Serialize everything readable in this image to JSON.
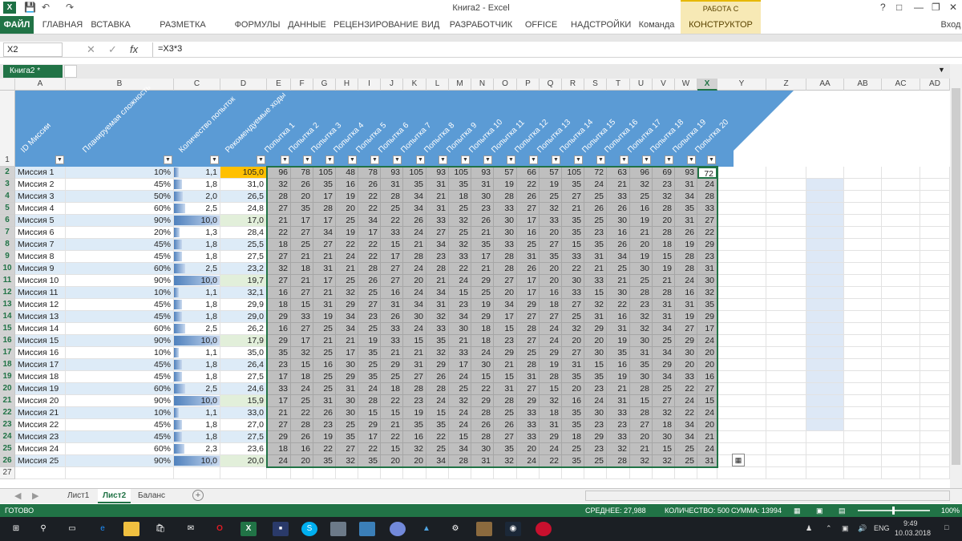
{
  "window": {
    "title": "Книга2 - Excel",
    "context_title": "РАБОТА С ТАБЛИЦАМИ",
    "help": "?",
    "user": "Вход"
  },
  "ribbon_tabs": [
    "ФАЙЛ",
    "ГЛАВНАЯ",
    "ВСТАВКА",
    "РАЗМЕТКА СТРАНИЦЫ",
    "ФОРМУЛЫ",
    "ДАННЫЕ",
    "РЕЦЕНЗИРОВАНИЕ",
    "ВИД",
    "РАЗРАБОТЧИК",
    "OFFICE TAB",
    "НАДСТРОЙКИ",
    "Команда",
    "КОНСТРУКТОР"
  ],
  "formula_bar": {
    "name_box": "X2",
    "fx": "fx",
    "formula": "=X3*3"
  },
  "workbook_tab": "Книга2 *",
  "columns": [
    "A",
    "B",
    "C",
    "D",
    "E",
    "F",
    "G",
    "H",
    "I",
    "J",
    "K",
    "L",
    "M",
    "N",
    "O",
    "P",
    "Q",
    "R",
    "S",
    "T",
    "U",
    "V",
    "W",
    "X",
    "Y",
    "Z",
    "AA",
    "AB",
    "AC",
    "AD"
  ],
  "selected_column": "X",
  "header_labels": {
    "a": "ID Миссии",
    "b": "Планируемая сложность",
    "c": "Количество попыток",
    "d": "Рекомендуемые ходы",
    "attempts": [
      "Попытка 1",
      "Попытка 2",
      "Попытка 3",
      "Попытка 4",
      "Попытка 5",
      "Попытка 6",
      "Попытка 7",
      "Попытка 8",
      "Попытка 9",
      "Попытка 10",
      "Попытка 11",
      "Попытка 12",
      "Попытка 13",
      "Попытка 14",
      "Попытка 15",
      "Попытка 16",
      "Попытка 17",
      "Попытка 18",
      "Попытка 19",
      "Попытка 20"
    ]
  },
  "rows": [
    {
      "id": "Миссия 1",
      "diff": "10%",
      "tries": "1,1",
      "rec": "105,0",
      "a": [
        96,
        78,
        105,
        48,
        78,
        93,
        105,
        93,
        105,
        93,
        57,
        66,
        57,
        105,
        72,
        63,
        96,
        69,
        93,
        72
      ]
    },
    {
      "id": "Миссия 2",
      "diff": "45%",
      "tries": "1,8",
      "rec": "31,0",
      "a": [
        32,
        26,
        35,
        16,
        26,
        31,
        35,
        31,
        35,
        31,
        19,
        22,
        19,
        35,
        24,
        21,
        32,
        23,
        31,
        24
      ]
    },
    {
      "id": "Миссия 3",
      "diff": "50%",
      "tries": "2,0",
      "rec": "26,5",
      "a": [
        28,
        20,
        17,
        19,
        22,
        28,
        34,
        21,
        18,
        30,
        28,
        26,
        25,
        27,
        25,
        33,
        25,
        32,
        34,
        28
      ]
    },
    {
      "id": "Миссия 4",
      "diff": "60%",
      "tries": "2,5",
      "rec": "24,8",
      "a": [
        27,
        35,
        28,
        20,
        22,
        25,
        34,
        31,
        25,
        23,
        33,
        27,
        32,
        21,
        26,
        26,
        16,
        28,
        35,
        33
      ]
    },
    {
      "id": "Миссия 5",
      "diff": "90%",
      "tries": "10,0",
      "rec": "17,0",
      "a": [
        21,
        17,
        17,
        25,
        34,
        22,
        26,
        33,
        32,
        26,
        30,
        17,
        33,
        35,
        25,
        30,
        19,
        20,
        31,
        27
      ]
    },
    {
      "id": "Миссия 6",
      "diff": "20%",
      "tries": "1,3",
      "rec": "28,4",
      "a": [
        22,
        27,
        34,
        19,
        17,
        33,
        24,
        27,
        25,
        21,
        30,
        16,
        20,
        35,
        23,
        16,
        21,
        28,
        26,
        22
      ]
    },
    {
      "id": "Миссия 7",
      "diff": "45%",
      "tries": "1,8",
      "rec": "25,5",
      "a": [
        18,
        25,
        27,
        22,
        22,
        15,
        21,
        34,
        32,
        35,
        33,
        25,
        27,
        15,
        35,
        26,
        20,
        18,
        19,
        29
      ]
    },
    {
      "id": "Миссия 8",
      "diff": "45%",
      "tries": "1,8",
      "rec": "27,5",
      "a": [
        27,
        21,
        21,
        24,
        22,
        17,
        28,
        23,
        33,
        17,
        28,
        31,
        35,
        33,
        31,
        34,
        19,
        15,
        28,
        23
      ]
    },
    {
      "id": "Миссия 9",
      "diff": "60%",
      "tries": "2,5",
      "rec": "23,2",
      "a": [
        32,
        18,
        31,
        21,
        28,
        27,
        24,
        28,
        22,
        21,
        28,
        26,
        20,
        22,
        21,
        25,
        30,
        19,
        28,
        31
      ]
    },
    {
      "id": "Миссия 10",
      "diff": "90%",
      "tries": "10,0",
      "rec": "19,7",
      "a": [
        27,
        21,
        17,
        25,
        26,
        27,
        20,
        21,
        24,
        29,
        27,
        17,
        20,
        30,
        33,
        21,
        25,
        21,
        24,
        30
      ]
    },
    {
      "id": "Миссия 11",
      "diff": "10%",
      "tries": "1,1",
      "rec": "32,1",
      "a": [
        16,
        27,
        21,
        32,
        25,
        16,
        24,
        34,
        15,
        25,
        20,
        17,
        16,
        33,
        15,
        30,
        28,
        28,
        16,
        32
      ]
    },
    {
      "id": "Миссия 12",
      "diff": "45%",
      "tries": "1,8",
      "rec": "29,9",
      "a": [
        18,
        15,
        31,
        29,
        27,
        31,
        34,
        31,
        23,
        19,
        34,
        29,
        18,
        27,
        32,
        22,
        23,
        31,
        31,
        35
      ]
    },
    {
      "id": "Миссия 13",
      "diff": "45%",
      "tries": "1,8",
      "rec": "29,0",
      "a": [
        29,
        33,
        19,
        34,
        23,
        26,
        30,
        32,
        34,
        29,
        17,
        27,
        27,
        25,
        31,
        16,
        32,
        31,
        19,
        29
      ]
    },
    {
      "id": "Миссия 14",
      "diff": "60%",
      "tries": "2,5",
      "rec": "26,2",
      "a": [
        16,
        27,
        25,
        34,
        25,
        33,
        24,
        33,
        30,
        18,
        15,
        28,
        24,
        32,
        29,
        31,
        32,
        34,
        27,
        17
      ]
    },
    {
      "id": "Миссия 15",
      "diff": "90%",
      "tries": "10,0",
      "rec": "17,9",
      "a": [
        29,
        17,
        21,
        21,
        19,
        33,
        15,
        35,
        21,
        18,
        23,
        27,
        24,
        20,
        20,
        19,
        30,
        25,
        29,
        24
      ]
    },
    {
      "id": "Миссия 16",
      "diff": "10%",
      "tries": "1,1",
      "rec": "35,0",
      "a": [
        35,
        32,
        25,
        17,
        35,
        21,
        21,
        32,
        33,
        24,
        29,
        25,
        29,
        27,
        30,
        35,
        31,
        34,
        30,
        20
      ]
    },
    {
      "id": "Миссия 17",
      "diff": "45%",
      "tries": "1,8",
      "rec": "26,4",
      "a": [
        23,
        15,
        16,
        30,
        25,
        29,
        31,
        29,
        17,
        30,
        21,
        28,
        19,
        31,
        15,
        16,
        35,
        29,
        20,
        20
      ]
    },
    {
      "id": "Миссия 18",
      "diff": "45%",
      "tries": "1,8",
      "rec": "27,5",
      "a": [
        17,
        18,
        25,
        29,
        35,
        25,
        27,
        26,
        24,
        15,
        15,
        31,
        28,
        35,
        35,
        19,
        30,
        34,
        33,
        16
      ]
    },
    {
      "id": "Миссия 19",
      "diff": "60%",
      "tries": "2,5",
      "rec": "24,6",
      "a": [
        33,
        24,
        25,
        31,
        24,
        18,
        28,
        28,
        25,
        22,
        31,
        27,
        15,
        20,
        23,
        21,
        28,
        25,
        22,
        27
      ]
    },
    {
      "id": "Миссия 20",
      "diff": "90%",
      "tries": "10,0",
      "rec": "15,9",
      "a": [
        17,
        25,
        31,
        30,
        28,
        22,
        23,
        24,
        32,
        29,
        28,
        29,
        32,
        16,
        24,
        31,
        15,
        27,
        24,
        15
      ]
    },
    {
      "id": "Миссия 21",
      "diff": "10%",
      "tries": "1,1",
      "rec": "33,0",
      "a": [
        21,
        22,
        26,
        30,
        15,
        15,
        19,
        15,
        24,
        28,
        25,
        33,
        18,
        35,
        30,
        33,
        28,
        32,
        22,
        24
      ]
    },
    {
      "id": "Миссия 22",
      "diff": "45%",
      "tries": "1,8",
      "rec": "27,0",
      "a": [
        27,
        28,
        23,
        25,
        29,
        21,
        35,
        35,
        24,
        26,
        26,
        33,
        31,
        35,
        23,
        23,
        27,
        18,
        34,
        20
      ]
    },
    {
      "id": "Миссия 23",
      "diff": "45%",
      "tries": "1,8",
      "rec": "27,5",
      "a": [
        29,
        26,
        19,
        35,
        17,
        22,
        16,
        22,
        15,
        28,
        27,
        33,
        29,
        18,
        29,
        33,
        20,
        30,
        34,
        21
      ]
    },
    {
      "id": "Миссия 24",
      "diff": "60%",
      "tries": "2,3",
      "rec": "23,6",
      "a": [
        18,
        16,
        22,
        27,
        22,
        15,
        32,
        25,
        34,
        30,
        35,
        20,
        24,
        25,
        23,
        32,
        21,
        15,
        25,
        24
      ]
    },
    {
      "id": "Миссия 25",
      "diff": "90%",
      "tries": "10,0",
      "rec": "20,0",
      "a": [
        24,
        20,
        35,
        32,
        35,
        20,
        20,
        34,
        28,
        31,
        32,
        24,
        22,
        35,
        25,
        28,
        32,
        32,
        25,
        31
      ]
    }
  ],
  "row_numbers": [
    "1",
    "2",
    "3",
    "4",
    "5",
    "6",
    "7",
    "8",
    "9",
    "10",
    "11",
    "12",
    "13",
    "14",
    "15",
    "16",
    "17",
    "18",
    "19",
    "20",
    "21",
    "22",
    "23",
    "24",
    "25",
    "26",
    "27"
  ],
  "sheets": [
    "Лист1",
    "Лист2",
    "Баланс"
  ],
  "active_sheet": "Лист2",
  "status": {
    "ready": "ГОТОВО",
    "average": "СРЕДНЕЕ: 27,988",
    "count": "КОЛИЧЕСТВО: 500",
    "sum": "СУММА: 13994",
    "zoom": "100%"
  },
  "taskbar": {
    "lang": "ENG",
    "time": "9:49",
    "date": "10.03.2018"
  },
  "colors": {
    "excel_green": "#217346",
    "header_blue": "#5b9bd5",
    "band_light": "#ddebf7",
    "attempt_gray": "#bfbfbf",
    "highlight_orange": "#ffc000",
    "light_green": "#e2efda"
  }
}
